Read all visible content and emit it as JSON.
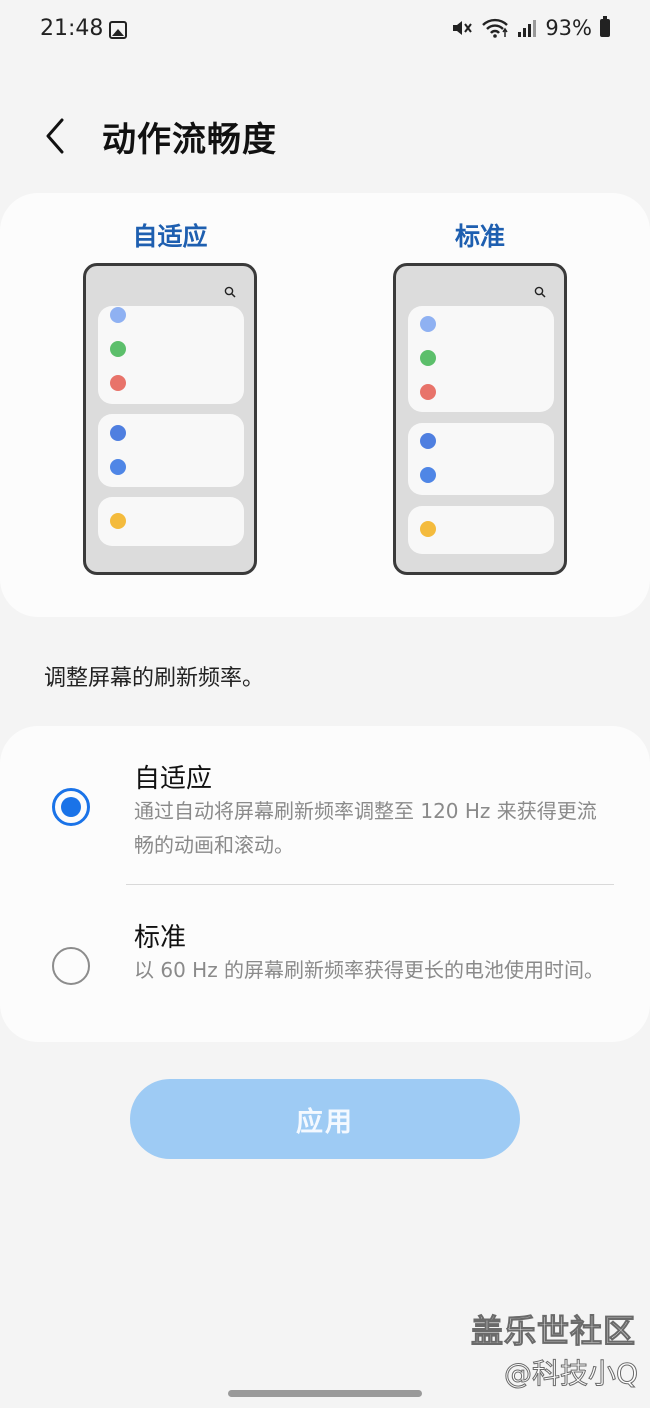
{
  "status_bar": {
    "time": "21:48",
    "battery": "93%",
    "icons": [
      "image-icon",
      "mute-icon",
      "wifi-icon",
      "signal-icon",
      "battery-icon"
    ]
  },
  "header": {
    "title": "动作流畅度",
    "back_icon": "chevron-left-icon"
  },
  "preview": {
    "adaptive_label": "自适应",
    "standard_label": "标准",
    "dot_colors": [
      "#8fb1f2",
      "#5cbf6b",
      "#e8736a",
      "#4f7fe0",
      "#4f86e6",
      "#f4bb3d"
    ]
  },
  "description": "调整屏幕的刷新频率。",
  "options": [
    {
      "title": "自适应",
      "description": "通过自动将屏幕刷新频率调整至 120 Hz 来获得更流畅的动画和滚动。",
      "selected": true
    },
    {
      "title": "标准",
      "description": "以 60 Hz 的屏幕刷新频率获得更长的电池使用时间。",
      "selected": false
    }
  ],
  "apply_label": "应用",
  "watermark": {
    "line1": "盖乐世社区",
    "line2": "@科技小Q"
  },
  "colors": {
    "accent": "#1a73e8",
    "preview_label": "#1e5fb0",
    "apply_bg": "#9ecbf4"
  }
}
